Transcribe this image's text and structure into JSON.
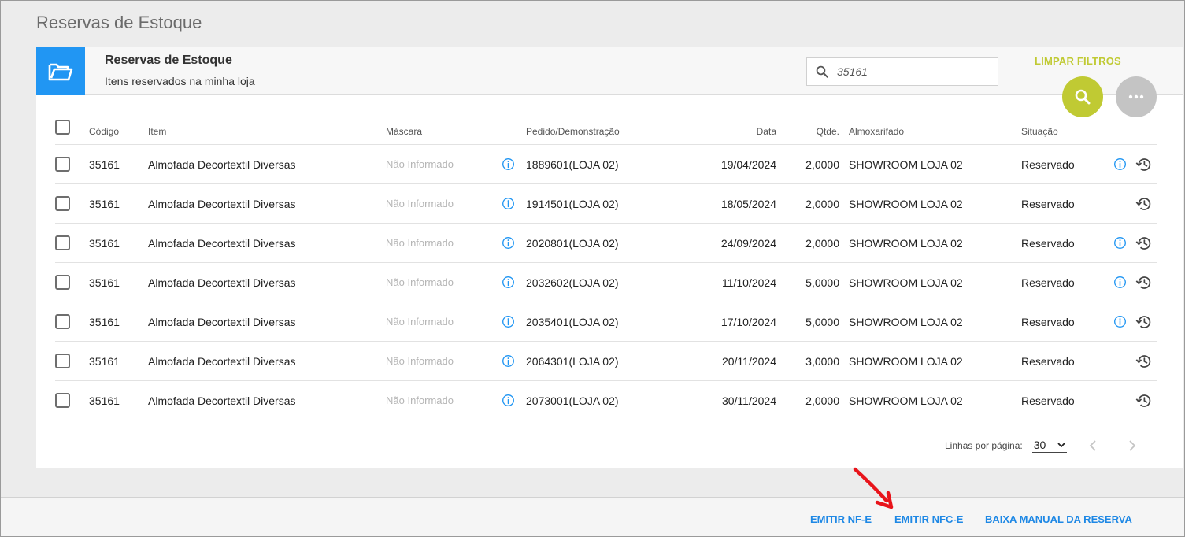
{
  "page": {
    "title": "Reservas de Estoque"
  },
  "card": {
    "title": "Reservas de Estoque",
    "subtitle": "Itens reservados na minha loja",
    "search_value": "35161",
    "clear_filters": "LIMPAR FILTROS",
    "folder_icon": "folder-open-icon"
  },
  "table": {
    "headers": {
      "code": "Código",
      "item": "Item",
      "mask": "Máscara",
      "order": "Pedido/Demonstração",
      "date": "Data",
      "qty": "Qtde.",
      "warehouse": "Almoxarifado",
      "status": "Situação"
    },
    "rows": [
      {
        "code": "35161",
        "item": "Almofada Decortextil Diversas",
        "mask": "Não Informado",
        "order": "1889601(LOJA 02)",
        "date": "19/04/2024",
        "qty": "2,0000",
        "warehouse": "SHOWROOM LOJA 02",
        "status": "Reservado",
        "row_info": true
      },
      {
        "code": "35161",
        "item": "Almofada Decortextil Diversas",
        "mask": "Não Informado",
        "order": "1914501(LOJA 02)",
        "date": "18/05/2024",
        "qty": "2,0000",
        "warehouse": "SHOWROOM LOJA 02",
        "status": "Reservado",
        "row_info": false
      },
      {
        "code": "35161",
        "item": "Almofada Decortextil Diversas",
        "mask": "Não Informado",
        "order": "2020801(LOJA 02)",
        "date": "24/09/2024",
        "qty": "2,0000",
        "warehouse": "SHOWROOM LOJA 02",
        "status": "Reservado",
        "row_info": true
      },
      {
        "code": "35161",
        "item": "Almofada Decortextil Diversas",
        "mask": "Não Informado",
        "order": "2032602(LOJA 02)",
        "date": "11/10/2024",
        "qty": "5,0000",
        "warehouse": "SHOWROOM LOJA 02",
        "status": "Reservado",
        "row_info": true
      },
      {
        "code": "35161",
        "item": "Almofada Decortextil Diversas",
        "mask": "Não Informado",
        "order": "2035401(LOJA 02)",
        "date": "17/10/2024",
        "qty": "5,0000",
        "warehouse": "SHOWROOM LOJA 02",
        "status": "Reservado",
        "row_info": true
      },
      {
        "code": "35161",
        "item": "Almofada Decortextil Diversas",
        "mask": "Não Informado",
        "order": "2064301(LOJA 02)",
        "date": "20/11/2024",
        "qty": "3,0000",
        "warehouse": "SHOWROOM LOJA 02",
        "status": "Reservado",
        "row_info": false
      },
      {
        "code": "35161",
        "item": "Almofada Decortextil Diversas",
        "mask": "Não Informado",
        "order": "2073001(LOJA 02)",
        "date": "30/11/2024",
        "qty": "2,0000",
        "warehouse": "SHOWROOM LOJA 02",
        "status": "Reservado",
        "row_info": false
      }
    ]
  },
  "pagination": {
    "label": "Linhas por página:",
    "rows_per_page": "30"
  },
  "footer": {
    "emit_nfe": "EMITIR NF-E",
    "emit_nfce": "EMITIR NFC-E",
    "manual_release": "BAIXA MANUAL DA RESERVA"
  },
  "colors": {
    "primary_blue": "#2196f3",
    "link_blue": "#1e88e5",
    "accent_lime": "#c0ca33",
    "fab_gray": "#c4c4c4",
    "arrow_red": "#e8141b"
  },
  "icons": [
    "folder-open-icon",
    "search-icon",
    "more-icon",
    "info-icon",
    "history-icon",
    "chevron-down-icon",
    "chevron-left-icon",
    "chevron-right-icon"
  ]
}
